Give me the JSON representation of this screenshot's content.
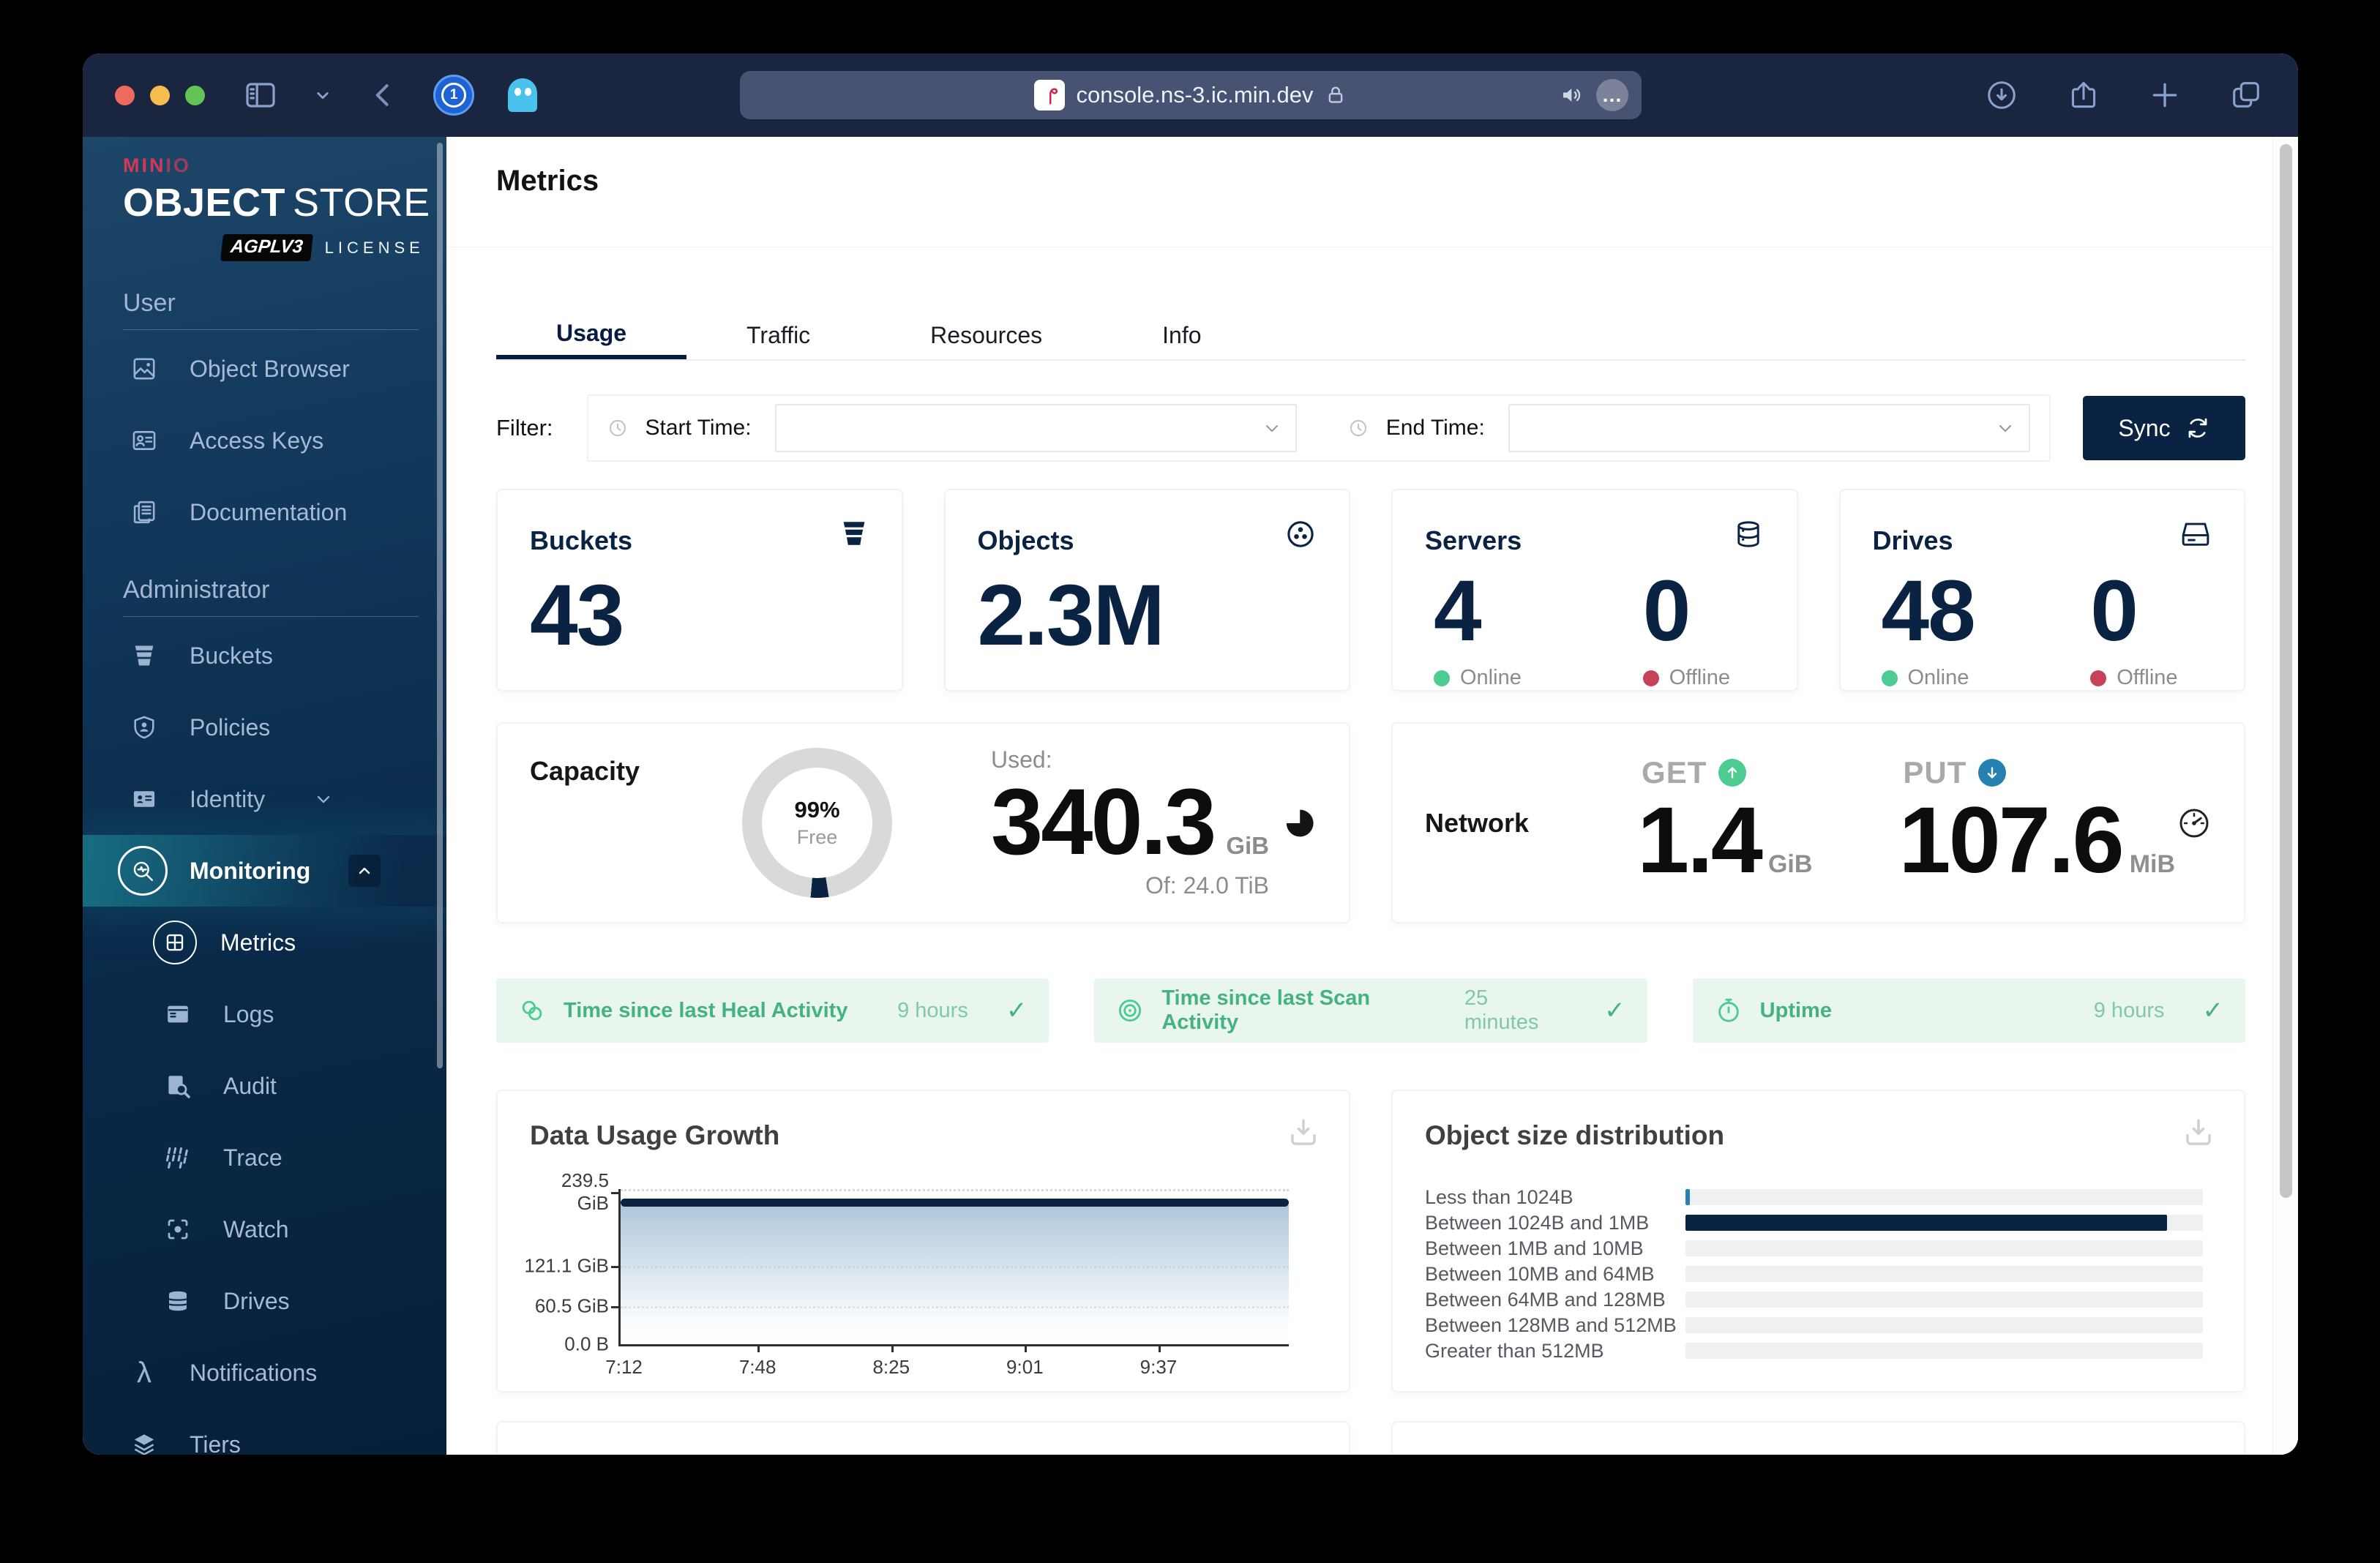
{
  "browser": {
    "url": "console.ns-3.ic.min.dev",
    "more_glyph": "…"
  },
  "sidebar": {
    "logo": {
      "brand_prefix": "MIN",
      "brand_suffix": "IO",
      "product_bold": "OBJECT",
      "product_light": "STORE",
      "license_badge": "AGPLV3",
      "license_text": "LICENSE"
    },
    "sections": [
      {
        "header": "User",
        "items": [
          {
            "label": "Object Browser"
          },
          {
            "label": "Access Keys"
          },
          {
            "label": "Documentation"
          }
        ]
      },
      {
        "header": "Administrator",
        "items": [
          {
            "label": "Buckets"
          },
          {
            "label": "Policies"
          },
          {
            "label": "Identity"
          },
          {
            "label": "Monitoring"
          },
          {
            "label": "Metrics"
          },
          {
            "label": "Logs"
          },
          {
            "label": "Audit"
          },
          {
            "label": "Trace"
          },
          {
            "label": "Watch"
          },
          {
            "label": "Drives"
          },
          {
            "label": "Notifications"
          },
          {
            "label": "Tiers"
          }
        ]
      }
    ]
  },
  "main": {
    "page_title": "Metrics",
    "tabs": [
      {
        "label": "Usage",
        "active": true
      },
      {
        "label": "Traffic",
        "active": false
      },
      {
        "label": "Resources",
        "active": false
      },
      {
        "label": "Info",
        "active": false
      }
    ],
    "filter": {
      "label": "Filter:",
      "start_label": "Start Time:",
      "start_value": "",
      "end_label": "End Time:",
      "end_value": "",
      "sync_button": "Sync"
    },
    "stat_cards": [
      {
        "title": "Buckets",
        "value": "43"
      },
      {
        "title": "Objects",
        "value": "2.3M"
      },
      {
        "title": "Servers",
        "online_value": "4",
        "online_label": "Online",
        "offline_value": "0",
        "offline_label": "Offline"
      },
      {
        "title": "Drives",
        "online_value": "48",
        "online_label": "Online",
        "offline_value": "0",
        "offline_label": "Offline"
      }
    ],
    "capacity": {
      "title": "Capacity",
      "donut_percent": "99%",
      "donut_caption": "Free",
      "used_label": "Used:",
      "used_value": "340.3",
      "used_unit": "GiB",
      "total_label": "Of: 24.0 TiB"
    },
    "network": {
      "title": "Network",
      "get_label": "GET",
      "get_value": "1.4",
      "get_unit": "GiB",
      "put_label": "PUT",
      "put_value": "107.6",
      "put_unit": "MiB"
    },
    "status_bars": [
      {
        "label": "Time since last Heal Activity",
        "value": "9 hours",
        "check": "✓"
      },
      {
        "label": "Time since last Scan Activity",
        "value": "25 minutes",
        "check": "✓"
      },
      {
        "label": "Uptime",
        "value": "9 hours",
        "check": "✓"
      }
    ]
  },
  "chart_data": [
    {
      "type": "area",
      "title": "Data Usage Growth",
      "x_ticks": [
        "7:12",
        "7:48",
        "8:25",
        "9:01",
        "9:37"
      ],
      "y_ticks": [
        "239.5 GiB",
        "121.1 GiB",
        "60.5 GiB",
        "0.0 B"
      ],
      "ylim_gib": [
        0,
        239.5
      ],
      "series": [
        {
          "name": "Data Usage",
          "x": [
            "7:12",
            "7:48",
            "8:25",
            "9:01",
            "9:37"
          ],
          "values_gib": [
            225,
            225,
            225,
            225,
            225
          ]
        }
      ],
      "grid": "horizontal-dashed",
      "legend_position": "none"
    },
    {
      "type": "bar",
      "orientation": "horizontal",
      "title": "Object size distribution",
      "categories": [
        "Less than 1024B",
        "Between 1024B and 1MB",
        "Between 1MB and 10MB",
        "Between 10MB and 64MB",
        "Between 64MB and 128MB",
        "Between 128MB and 512MB",
        "Greater than 512MB"
      ],
      "values_pct_of_track": [
        0.9,
        93,
        0,
        0,
        0,
        0,
        0
      ],
      "bar_colors": [
        "#2781B0",
        "#0A2342",
        "#0A2342",
        "#0A2342",
        "#0A2342",
        "#0A2342",
        "#0A2342"
      ],
      "track_color": "#EEF0F2",
      "legend_position": "none"
    }
  ],
  "colors": {
    "accent_navy": "#081C42",
    "green": "#4CCB92",
    "red": "#C9405B",
    "teal_glow": "#24ACB8",
    "bar_blue": "#2781B0",
    "status_bg": "#E9F6EE"
  }
}
